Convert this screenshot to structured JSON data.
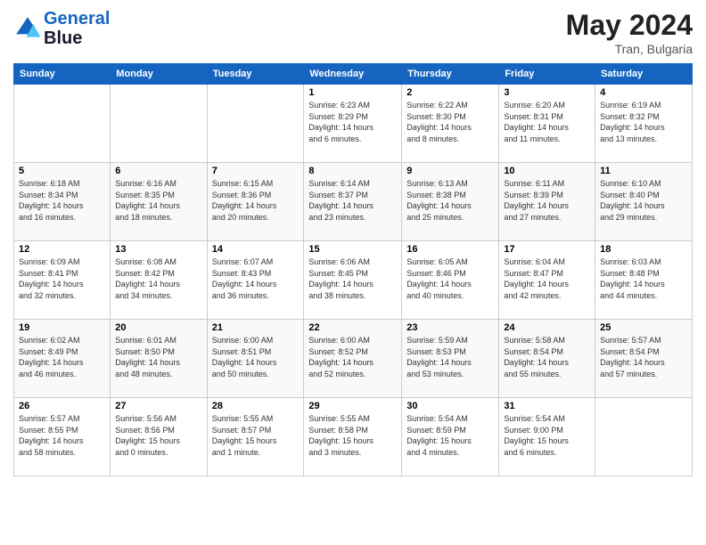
{
  "header": {
    "logo_line1": "General",
    "logo_line2": "Blue",
    "month_year": "May 2024",
    "location": "Tran, Bulgaria"
  },
  "days_of_week": [
    "Sunday",
    "Monday",
    "Tuesday",
    "Wednesday",
    "Thursday",
    "Friday",
    "Saturday"
  ],
  "weeks": [
    [
      {
        "day": "",
        "info": ""
      },
      {
        "day": "",
        "info": ""
      },
      {
        "day": "",
        "info": ""
      },
      {
        "day": "1",
        "info": "Sunrise: 6:23 AM\nSunset: 8:29 PM\nDaylight: 14 hours\nand 6 minutes."
      },
      {
        "day": "2",
        "info": "Sunrise: 6:22 AM\nSunset: 8:30 PM\nDaylight: 14 hours\nand 8 minutes."
      },
      {
        "day": "3",
        "info": "Sunrise: 6:20 AM\nSunset: 8:31 PM\nDaylight: 14 hours\nand 11 minutes."
      },
      {
        "day": "4",
        "info": "Sunrise: 6:19 AM\nSunset: 8:32 PM\nDaylight: 14 hours\nand 13 minutes."
      }
    ],
    [
      {
        "day": "5",
        "info": "Sunrise: 6:18 AM\nSunset: 8:34 PM\nDaylight: 14 hours\nand 16 minutes."
      },
      {
        "day": "6",
        "info": "Sunrise: 6:16 AM\nSunset: 8:35 PM\nDaylight: 14 hours\nand 18 minutes."
      },
      {
        "day": "7",
        "info": "Sunrise: 6:15 AM\nSunset: 8:36 PM\nDaylight: 14 hours\nand 20 minutes."
      },
      {
        "day": "8",
        "info": "Sunrise: 6:14 AM\nSunset: 8:37 PM\nDaylight: 14 hours\nand 23 minutes."
      },
      {
        "day": "9",
        "info": "Sunrise: 6:13 AM\nSunset: 8:38 PM\nDaylight: 14 hours\nand 25 minutes."
      },
      {
        "day": "10",
        "info": "Sunrise: 6:11 AM\nSunset: 8:39 PM\nDaylight: 14 hours\nand 27 minutes."
      },
      {
        "day": "11",
        "info": "Sunrise: 6:10 AM\nSunset: 8:40 PM\nDaylight: 14 hours\nand 29 minutes."
      }
    ],
    [
      {
        "day": "12",
        "info": "Sunrise: 6:09 AM\nSunset: 8:41 PM\nDaylight: 14 hours\nand 32 minutes."
      },
      {
        "day": "13",
        "info": "Sunrise: 6:08 AM\nSunset: 8:42 PM\nDaylight: 14 hours\nand 34 minutes."
      },
      {
        "day": "14",
        "info": "Sunrise: 6:07 AM\nSunset: 8:43 PM\nDaylight: 14 hours\nand 36 minutes."
      },
      {
        "day": "15",
        "info": "Sunrise: 6:06 AM\nSunset: 8:45 PM\nDaylight: 14 hours\nand 38 minutes."
      },
      {
        "day": "16",
        "info": "Sunrise: 6:05 AM\nSunset: 8:46 PM\nDaylight: 14 hours\nand 40 minutes."
      },
      {
        "day": "17",
        "info": "Sunrise: 6:04 AM\nSunset: 8:47 PM\nDaylight: 14 hours\nand 42 minutes."
      },
      {
        "day": "18",
        "info": "Sunrise: 6:03 AM\nSunset: 8:48 PM\nDaylight: 14 hours\nand 44 minutes."
      }
    ],
    [
      {
        "day": "19",
        "info": "Sunrise: 6:02 AM\nSunset: 8:49 PM\nDaylight: 14 hours\nand 46 minutes."
      },
      {
        "day": "20",
        "info": "Sunrise: 6:01 AM\nSunset: 8:50 PM\nDaylight: 14 hours\nand 48 minutes."
      },
      {
        "day": "21",
        "info": "Sunrise: 6:00 AM\nSunset: 8:51 PM\nDaylight: 14 hours\nand 50 minutes."
      },
      {
        "day": "22",
        "info": "Sunrise: 6:00 AM\nSunset: 8:52 PM\nDaylight: 14 hours\nand 52 minutes."
      },
      {
        "day": "23",
        "info": "Sunrise: 5:59 AM\nSunset: 8:53 PM\nDaylight: 14 hours\nand 53 minutes."
      },
      {
        "day": "24",
        "info": "Sunrise: 5:58 AM\nSunset: 8:54 PM\nDaylight: 14 hours\nand 55 minutes."
      },
      {
        "day": "25",
        "info": "Sunrise: 5:57 AM\nSunset: 8:54 PM\nDaylight: 14 hours\nand 57 minutes."
      }
    ],
    [
      {
        "day": "26",
        "info": "Sunrise: 5:57 AM\nSunset: 8:55 PM\nDaylight: 14 hours\nand 58 minutes."
      },
      {
        "day": "27",
        "info": "Sunrise: 5:56 AM\nSunset: 8:56 PM\nDaylight: 15 hours\nand 0 minutes."
      },
      {
        "day": "28",
        "info": "Sunrise: 5:55 AM\nSunset: 8:57 PM\nDaylight: 15 hours\nand 1 minute."
      },
      {
        "day": "29",
        "info": "Sunrise: 5:55 AM\nSunset: 8:58 PM\nDaylight: 15 hours\nand 3 minutes."
      },
      {
        "day": "30",
        "info": "Sunrise: 5:54 AM\nSunset: 8:59 PM\nDaylight: 15 hours\nand 4 minutes."
      },
      {
        "day": "31",
        "info": "Sunrise: 5:54 AM\nSunset: 9:00 PM\nDaylight: 15 hours\nand 6 minutes."
      },
      {
        "day": "",
        "info": ""
      }
    ]
  ]
}
